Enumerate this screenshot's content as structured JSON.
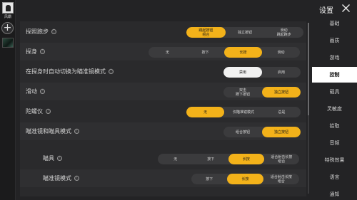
{
  "left": {
    "avatar_name": "风霸",
    "add_symbol": "+"
  },
  "header": {
    "title": "设置",
    "close_symbol": "✕"
  },
  "nav": {
    "items": [
      "基础",
      "画质",
      "游戏",
      "控制",
      "载具",
      "灵敏度",
      "拾取",
      "音频",
      "特殊效果",
      "语言",
      "通知"
    ],
    "active_index": 3
  },
  "settings": [
    {
      "label": "探照跑步",
      "info": "ⓘ",
      "options": [
        "跳起按钮\n组合",
        "独立按钮",
        "滑动\n跳起跑步"
      ],
      "selected": 0
    },
    {
      "label": "探身",
      "info": "ⓘ",
      "options": [
        "无",
        "按下",
        "长按",
        "滑动"
      ],
      "selected": 2
    },
    {
      "label": "在探身时自动切换为瞄准镜模式",
      "info": "ⓘ",
      "options": [
        "禁用",
        "启用"
      ],
      "selected": 0
    },
    {
      "label": "滑动",
      "info": "ⓘ",
      "options": [
        "双击\n蹲下按钮",
        "独立按钮"
      ],
      "selected": 1
    },
    {
      "label": "陀螺仪",
      "info": "ⓘ",
      "options": [
        "无",
        "仅瞄准镜模式",
        "总是"
      ],
      "selected": 0
    },
    {
      "label": "瞄准镜和瞄具模式",
      "info": "ⓘ",
      "options": [
        "组合按钮",
        "独立按钮"
      ],
      "selected": 1
    },
    {
      "label": "瞄具",
      "info": "ⓘ",
      "options": [
        "无",
        "按下",
        "长按",
        "适合射击长按\n组合"
      ],
      "selected": 2
    },
    {
      "label": "瞄准镜模式",
      "info": "ⓘ",
      "options": [
        "按下",
        "长按",
        "适合射击长按\n组合"
      ],
      "selected": 1
    }
  ],
  "colors": {
    "accent": "#f3b21a",
    "panel": "#2a2a2c",
    "background": "#232325"
  }
}
